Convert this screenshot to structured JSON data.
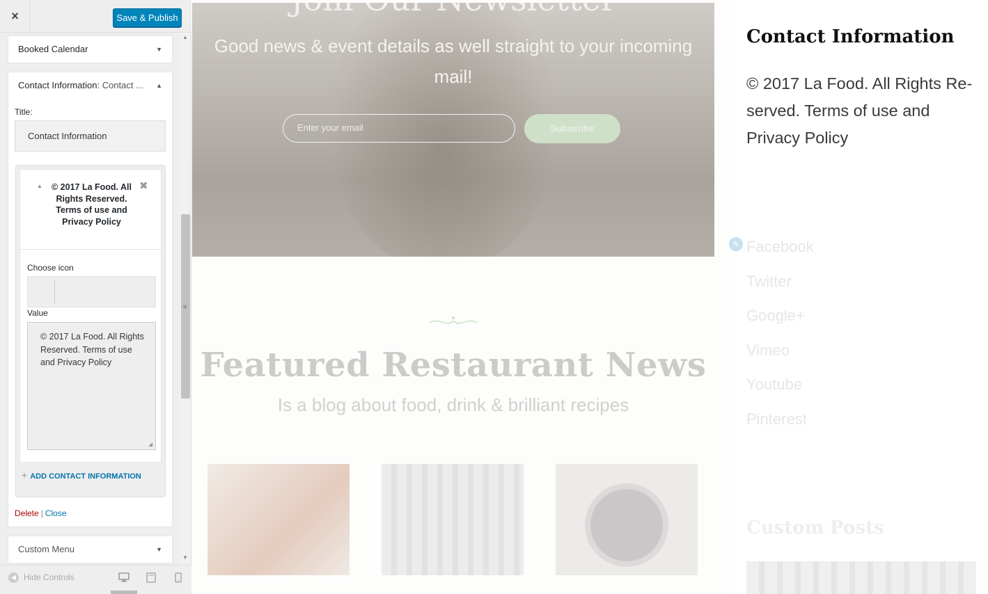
{
  "topbar": {
    "close_icon": "×",
    "save_label": "Save & Publish"
  },
  "widgets": {
    "booked": "Booked Calendar",
    "contact_head_strong": "Contact Information:",
    "contact_head_rest": "Contact ...",
    "custom_menu": "Custom Menu"
  },
  "contact_form": {
    "title_label": "Title:",
    "title_value": "Contact Information",
    "item_title": "© 2017 La Food. All Rights Reserved. Terms of use and Privacy Policy",
    "choose_icon_label": "Choose icon",
    "value_label": "Value",
    "value_text": "© 2017 La Food. All Rights Reserved. Terms of use and Privacy Policy",
    "add_label": "ADD CONTACT INFORMATION",
    "delete_label": "Delete",
    "close_label": "Close"
  },
  "footer": {
    "hide_controls": "Hide Controls"
  },
  "preview": {
    "newsletter_title": "Join Our Newsletter",
    "newsletter_sub": "Good news & event details as well straight to your incoming mail!",
    "email_placeholder": "Enter your email",
    "subscribe": "Subscribe",
    "featured_title": "Featured Restaurant News",
    "featured_sub": "Is a blog about food, drink & brilliant recipes",
    "contact_title": "Contact Information",
    "contact_text": "© 2017 La Food. All Rights Re-served. Terms of use and Privacy Policy",
    "social": [
      "Facebook",
      "Twitter",
      "Google+",
      "Vimeo",
      "Youtube",
      "Pinterest"
    ],
    "custom_posts": "Custom Posts"
  },
  "colors": {
    "primary_button": "#0085ba",
    "link": "#0073aa",
    "delete": "#aa0000"
  },
  "icons": [
    "close-icon",
    "chevron-down-icon",
    "chevron-up-icon",
    "remove-icon",
    "plus-icon",
    "desktop-icon",
    "tablet-icon",
    "mobile-icon",
    "pencil-icon",
    "ornament-icon"
  ]
}
